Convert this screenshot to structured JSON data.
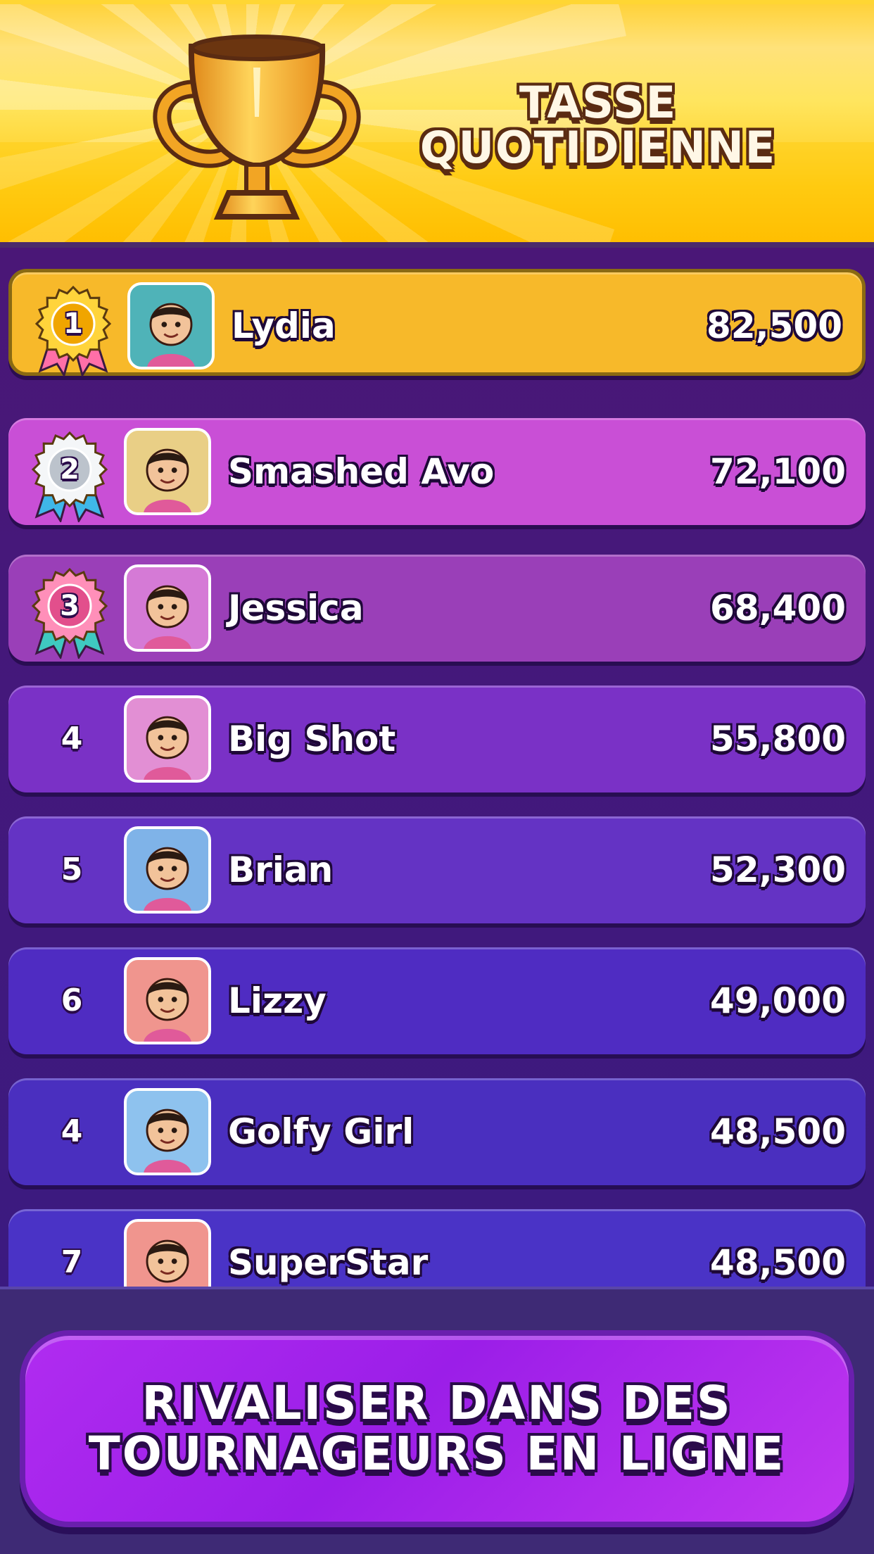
{
  "header": {
    "title": "TASSE QUOTIDIENNE",
    "trophy_icon": "trophy-icon"
  },
  "leaderboard": [
    {
      "rank": "1",
      "name": "Lydia",
      "score": "82,500",
      "medal": "gold",
      "row_color": "#f7b92a",
      "avatar_bg": "#4fb3b8"
    },
    {
      "rank": "2",
      "name": "Smashed Avo",
      "score": "72,100",
      "medal": "silver",
      "row_color": "#c94fd6",
      "avatar_bg": "#e9cf86"
    },
    {
      "rank": "3",
      "name": "Jessica",
      "score": "68,400",
      "medal": "bronze",
      "row_color": "#9a3fb8",
      "avatar_bg": "#d57ad6"
    },
    {
      "rank": "4",
      "name": "Big Shot",
      "score": "55,800",
      "medal": "",
      "row_color": "#7a31c6",
      "avatar_bg": "#e28fd4"
    },
    {
      "rank": "5",
      "name": "Brian",
      "score": "52,300",
      "medal": "",
      "row_color": "#6433c4",
      "avatar_bg": "#7fb3e8"
    },
    {
      "rank": "6",
      "name": "Lizzy",
      "score": "49,000",
      "medal": "",
      "row_color": "#4f2cc2",
      "avatar_bg": "#f0958e"
    },
    {
      "rank": "4",
      "name": "Golfy Girl",
      "score": "48,500",
      "medal": "",
      "row_color": "#4a2fbf",
      "avatar_bg": "#8ec2ee"
    },
    {
      "rank": "7",
      "name": "SuperStar",
      "score": "48,500",
      "medal": "",
      "row_color": "#4a33c6",
      "avatar_bg": "#f0958e"
    }
  ],
  "footer": {
    "cta_line1": "RIVALISER DANS DES",
    "cta_line2": "TOURNAGEURS EN LIGNE"
  },
  "colors": {
    "gold": "#f4b400",
    "silver": "#d9dde3",
    "bronze": "#f06a9e"
  }
}
